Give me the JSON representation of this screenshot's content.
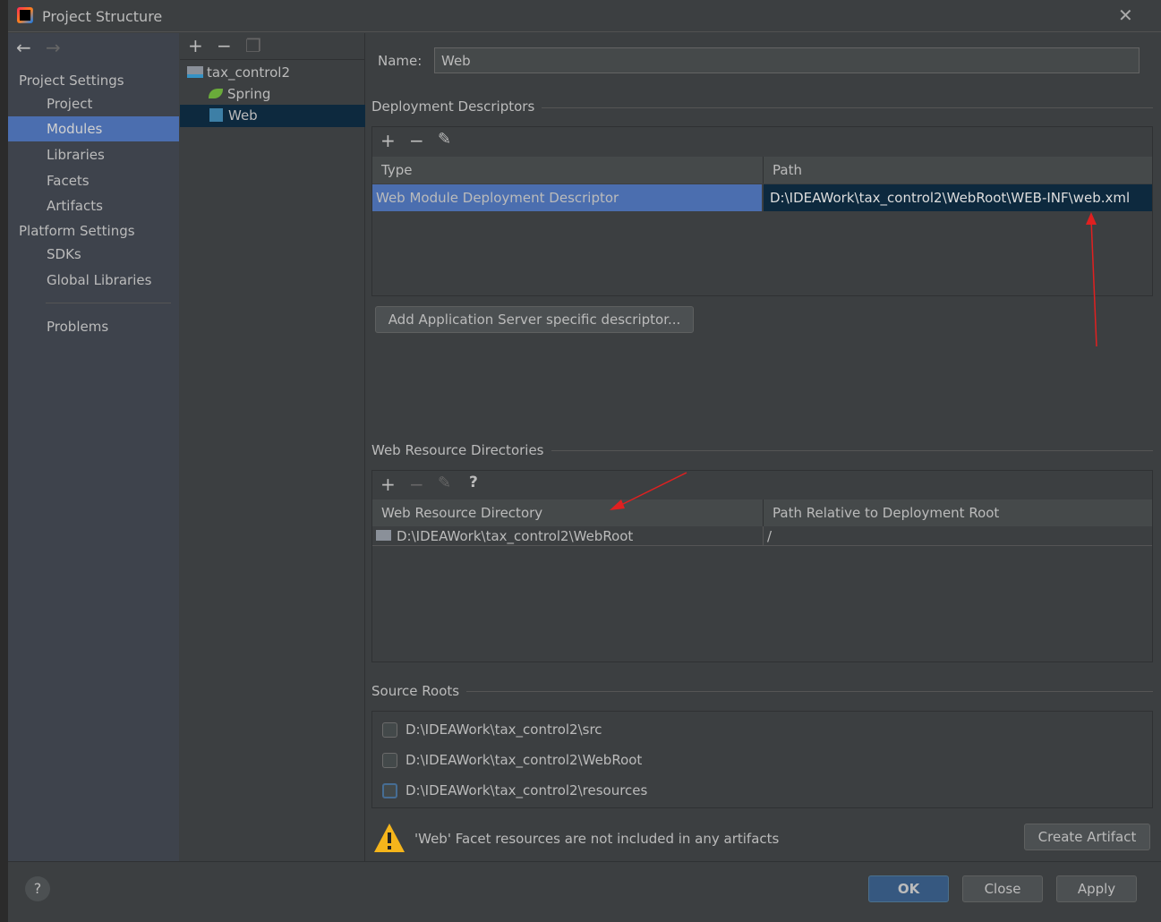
{
  "window": {
    "title": "Project Structure"
  },
  "sidebar": {
    "project_settings": "Project Settings",
    "items": [
      {
        "label": "Project"
      },
      {
        "label": "Modules"
      },
      {
        "label": "Libraries"
      },
      {
        "label": "Facets"
      },
      {
        "label": "Artifacts"
      }
    ],
    "platform_settings": "Platform Settings",
    "platform_items": [
      {
        "label": "SDKs"
      },
      {
        "label": "Global Libraries"
      }
    ],
    "problems": "Problems"
  },
  "tree": {
    "nodes": [
      {
        "label": "tax_control2"
      },
      {
        "label": "Spring"
      },
      {
        "label": "Web"
      }
    ]
  },
  "name_field": {
    "label": "Name:",
    "value": "Web"
  },
  "deployment": {
    "title": "Deployment Descriptors",
    "columns": [
      "Type",
      "Path"
    ],
    "rows": [
      {
        "type": "Web Module Deployment Descriptor",
        "path": "D:\\IDEAWork\\tax_control2\\WebRoot\\WEB-INF\\web.xml"
      }
    ],
    "add_button": "Add Application Server specific descriptor..."
  },
  "web_resources": {
    "title": "Web Resource Directories",
    "help": "?",
    "columns": [
      "Web Resource Directory",
      "Path Relative to Deployment Root"
    ],
    "rows": [
      {
        "dir": "D:\\IDEAWork\\tax_control2\\WebRoot",
        "rel": "/"
      }
    ]
  },
  "source_roots": {
    "title": "Source Roots",
    "items": [
      {
        "label": "D:\\IDEAWork\\tax_control2\\src",
        "checked": false
      },
      {
        "label": "D:\\IDEAWork\\tax_control2\\WebRoot",
        "checked": false
      },
      {
        "label": "D:\\IDEAWork\\tax_control2\\resources",
        "checked": false
      }
    ]
  },
  "warning": {
    "text": "'Web' Facet resources are not included in any artifacts",
    "button": "Create Artifact"
  },
  "footer": {
    "help": "?",
    "ok": "OK",
    "close": "Close",
    "apply": "Apply"
  },
  "colors": {
    "selection": "#4b6eaf",
    "tree_selection": "#0d293e",
    "background": "#3c3f41",
    "arrow": "#e02020"
  }
}
